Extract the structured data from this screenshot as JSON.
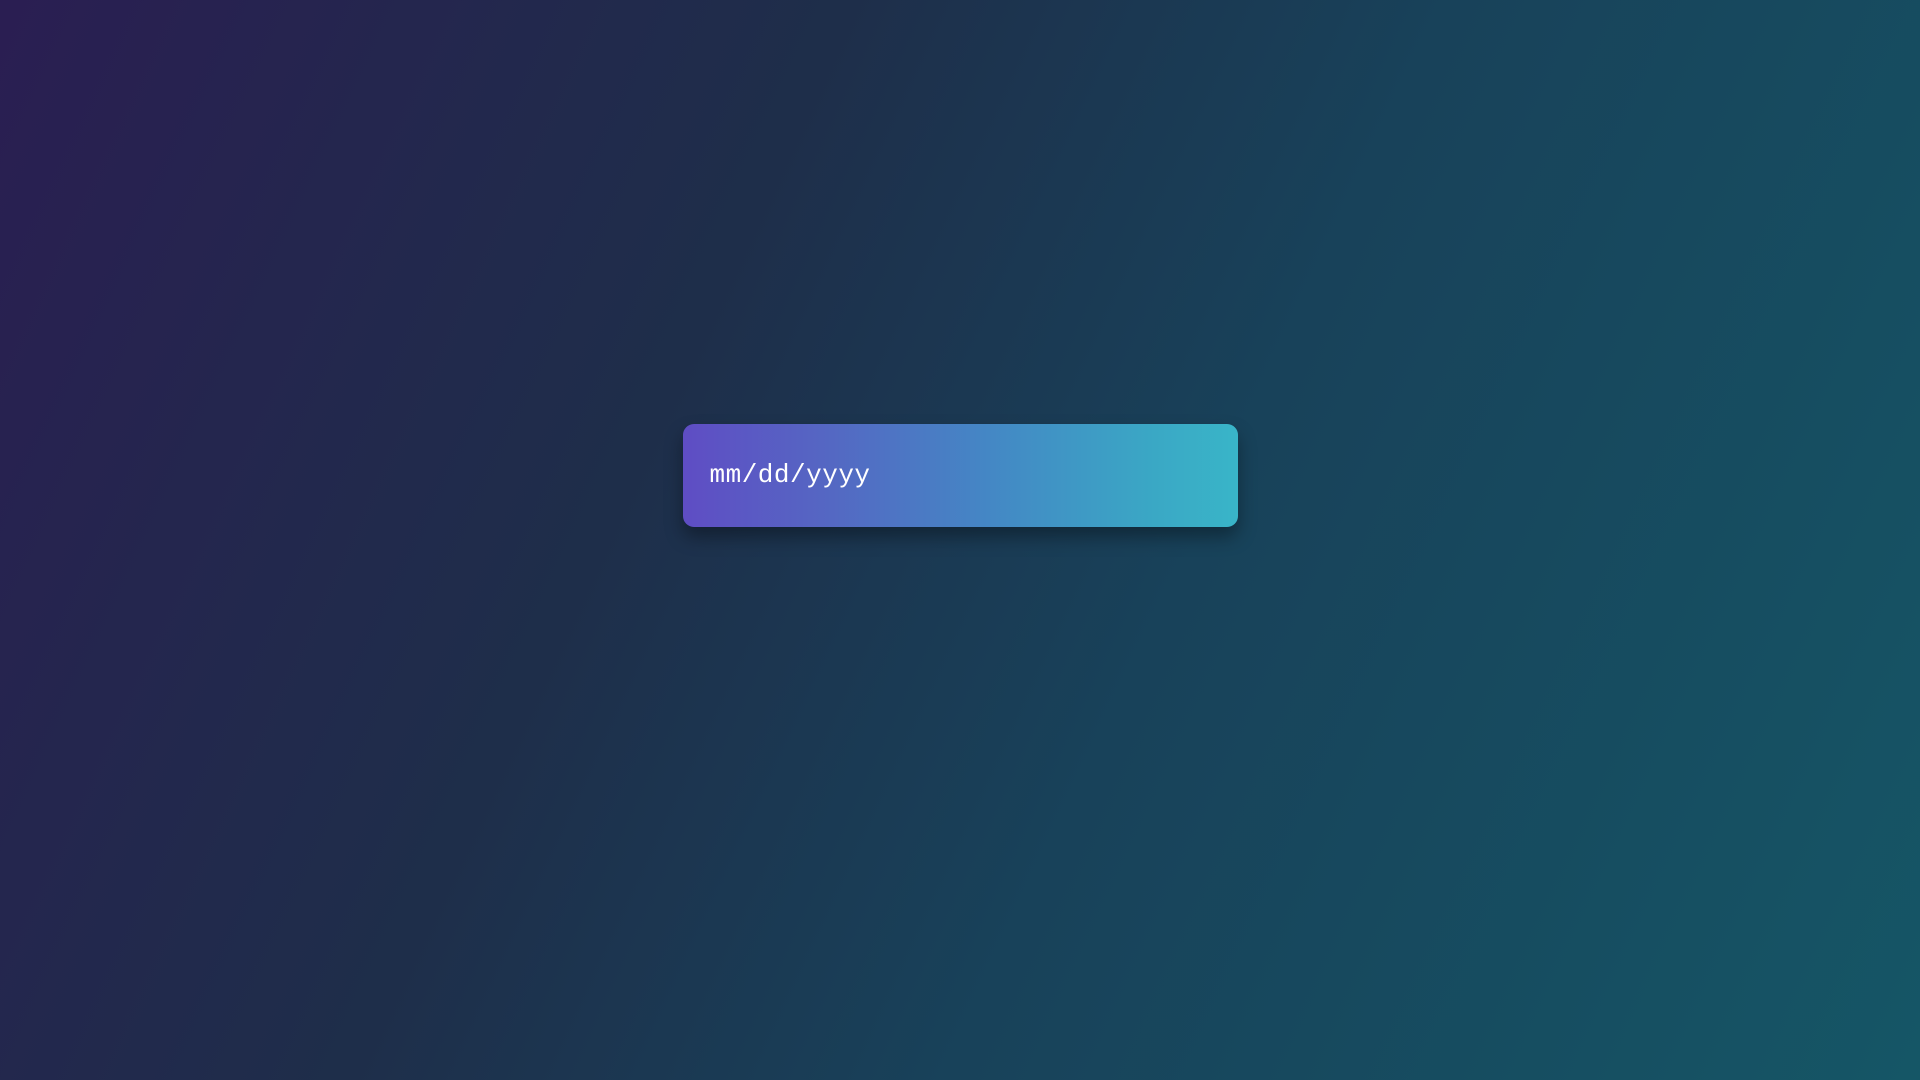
{
  "date_input": {
    "placeholder": "mm/dd/yyyy"
  }
}
